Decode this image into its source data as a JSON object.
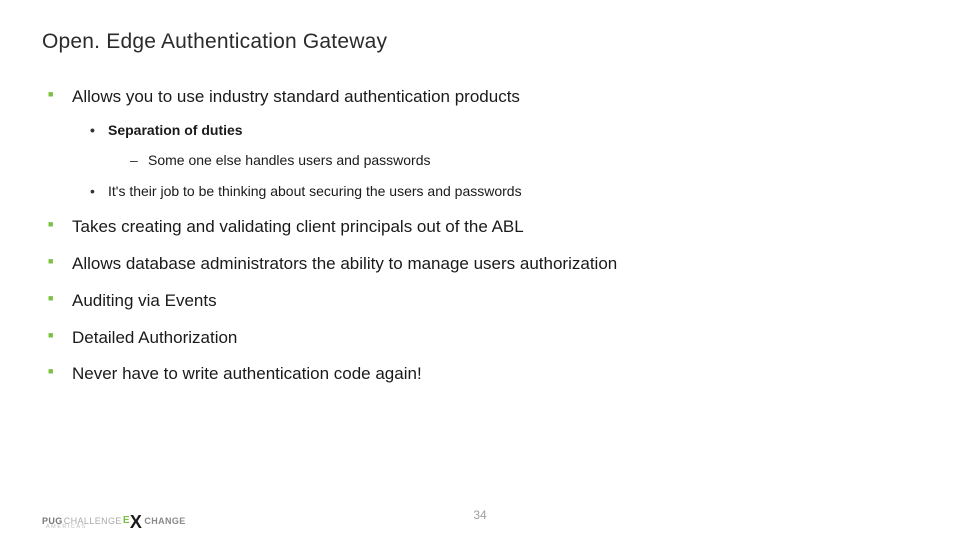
{
  "title": "Open. Edge Authentication Gateway",
  "bullets": {
    "b0": "Allows you to use industry standard authentication products",
    "b0_sub": {
      "s0": "Separation of duties",
      "s0_sub": {
        "d0": "Some one else handles users and passwords"
      },
      "s1": "It's their job to be thinking about securing the users and passwords"
    },
    "b1": "Takes creating and  validating client principals out of the ABL",
    "b2": "Allows database administrators the ability to manage users  authorization",
    "b3": "Auditing via Events",
    "b4": "Detailed Authorization",
    "b5": "Never have to write authentication code again!"
  },
  "footer": {
    "page": "34",
    "logo": {
      "pug": "PUG",
      "challenge": "CHALLENGE",
      "e": "E",
      "x": "X",
      "change": "CHANGE",
      "americas": "AMERICAS"
    }
  }
}
